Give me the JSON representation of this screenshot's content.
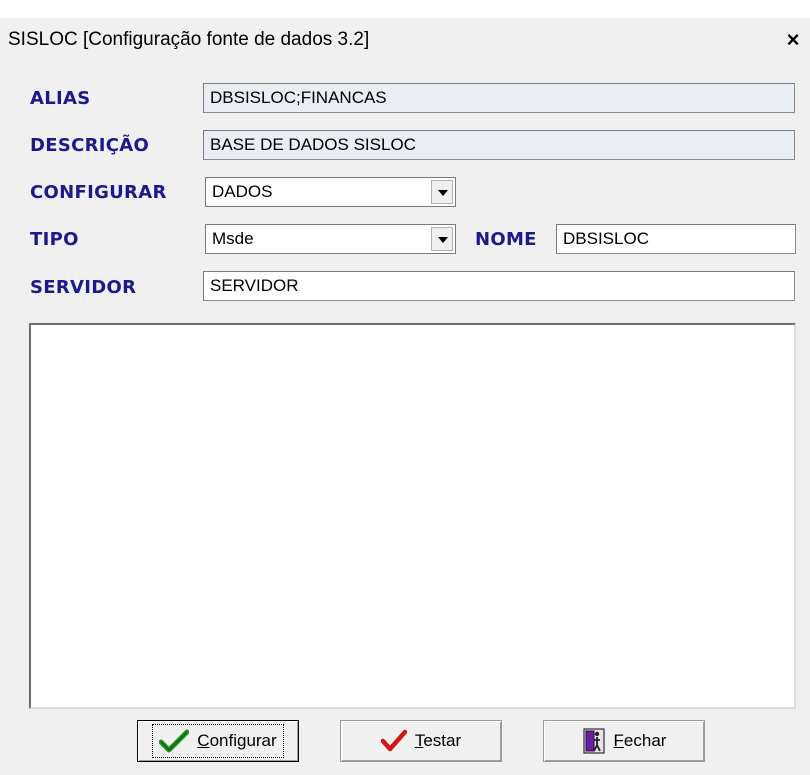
{
  "window": {
    "title": "SISLOC [Configuração fonte de dados 3.2]",
    "close_label": "×"
  },
  "form": {
    "alias_label": "ALIAS",
    "alias_value": "DBSISLOC;FINANCAS",
    "descricao_label": "DESCRIÇÃO",
    "descricao_value": "BASE DE DADOS SISLOC",
    "configurar_label": "CONFIGURAR",
    "configurar_value": "DADOS",
    "tipo_label": "TIPO",
    "tipo_value": "Msde",
    "nome_label": "NOME",
    "nome_value": "DBSISLOC",
    "servidor_label": "SERVIDOR",
    "servidor_value": "SERVIDOR"
  },
  "memo": {
    "value": ""
  },
  "buttons": {
    "configurar": {
      "accel": "C",
      "rest": "onfigurar",
      "icon": "green-check-icon"
    },
    "testar": {
      "accel": "T",
      "rest": "estar",
      "icon": "red-check-icon"
    },
    "fechar": {
      "accel": "F",
      "rest": "echar",
      "icon": "door-exit-icon"
    }
  },
  "colors": {
    "label": "#1a1a8c",
    "readonly_field": "#e9eef4",
    "dialog_bg": "#f0f0f0"
  }
}
